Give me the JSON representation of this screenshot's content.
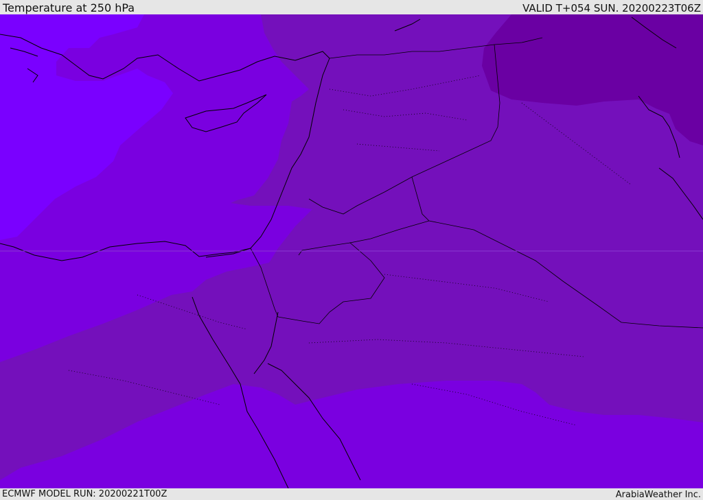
{
  "header": {
    "title": "Temperature at 250 hPa",
    "valid_time": "VALID T+054 SUN. 20200223T06Z"
  },
  "footer": {
    "model_run": "ECMWF MODEL RUN: 20200221T00Z",
    "credit": "ArabiaWeather Inc."
  },
  "map": {
    "field": "temperature",
    "level_hpa": 250,
    "colors": {
      "warmest": "#7a00ff",
      "warm": "#7a00e0",
      "mid": "#7410bb",
      "cold": "#6a00a3",
      "borders": "#000000"
    }
  }
}
